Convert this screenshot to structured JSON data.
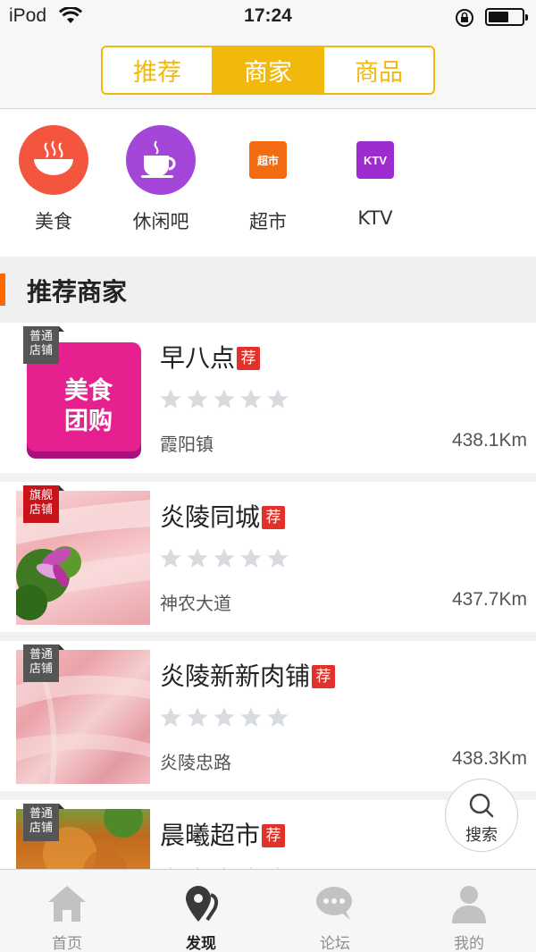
{
  "status": {
    "carrier": "iPod",
    "time": "17:24",
    "battery_level": 0.6
  },
  "segments": [
    {
      "label": "推荐",
      "active": false
    },
    {
      "label": "商家",
      "active": true
    },
    {
      "label": "商品",
      "active": false
    }
  ],
  "categories": [
    {
      "label": "美食",
      "icon": "bowl-icon"
    },
    {
      "label": "休闲吧",
      "icon": "coffee-cup-icon"
    },
    {
      "label": "超市",
      "icon": "supermarket-icon",
      "badge": "超市"
    },
    {
      "label": "KTV",
      "icon": "ktv-icon",
      "badge": "KTV"
    }
  ],
  "section_title": "推荐商家",
  "shops": [
    {
      "name": "早八点",
      "rec": "荐",
      "tag": [
        "普通",
        "店铺"
      ],
      "address": "霞阳镇",
      "distance": "438.1Km",
      "rating": 0,
      "logo_text": [
        "美食",
        "团购"
      ]
    },
    {
      "name": "炎陵同城",
      "rec": "荐",
      "tag": [
        "旗舰",
        "店铺"
      ],
      "address": "神农大道",
      "distance": "437.7Km",
      "rating": 0
    },
    {
      "name": "炎陵新新肉铺",
      "rec": "荐",
      "tag": [
        "普通",
        "店铺"
      ],
      "address": "炎陵忠路",
      "distance": "438.3Km",
      "rating": 0
    },
    {
      "name": "晨曦超市",
      "rec": "荐",
      "tag": [
        "普通",
        "店铺"
      ],
      "address": "",
      "distance": "",
      "rating": 0
    }
  ],
  "search_fab": {
    "label": "搜索"
  },
  "tabs": [
    {
      "label": "首页",
      "icon": "home-icon",
      "active": false
    },
    {
      "label": "发现",
      "icon": "location-pin-icon",
      "active": true
    },
    {
      "label": "论坛",
      "icon": "chat-bubble-icon",
      "active": false
    },
    {
      "label": "我的",
      "icon": "person-icon",
      "active": false
    }
  ],
  "colors": {
    "accent": "#f2b90d",
    "section_marker": "#ff6a00",
    "rec_badge": "#e0322b",
    "flagship_tag": "#c8131b",
    "normal_tag": "#555555",
    "star_empty": "#d8dbe0"
  }
}
